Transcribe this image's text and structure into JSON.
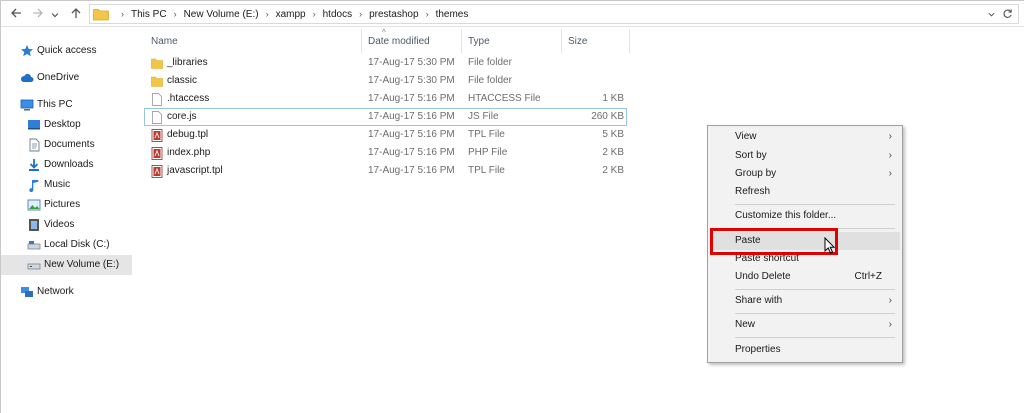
{
  "toolbar": {
    "back_icon": "arrow-left-icon",
    "forward_icon": "arrow-right-icon",
    "history_icon": "chevron-down-icon",
    "up_icon": "arrow-up-icon",
    "breadcrumb": [
      "This PC",
      "New Volume (E:)",
      "xampp",
      "htdocs",
      "prestashop",
      "themes"
    ],
    "refresh_icon": "refresh-icon"
  },
  "nav": {
    "items": [
      {
        "label": "Quick access",
        "icon": "star-icon"
      },
      {
        "label": "OneDrive",
        "icon": "cloud-icon"
      },
      {
        "label": "This PC",
        "icon": "computer-icon"
      },
      {
        "label": "Desktop",
        "icon": "desktop-icon"
      },
      {
        "label": "Documents",
        "icon": "documents-icon"
      },
      {
        "label": "Downloads",
        "icon": "download-icon"
      },
      {
        "label": "Music",
        "icon": "music-icon"
      },
      {
        "label": "Pictures",
        "icon": "pictures-icon"
      },
      {
        "label": "Videos",
        "icon": "videos-icon"
      },
      {
        "label": "Local Disk (C:)",
        "icon": "drive-icon"
      },
      {
        "label": "New Volume (E:)",
        "icon": "drive-icon"
      },
      {
        "label": "Network",
        "icon": "network-icon"
      }
    ],
    "selected": "New Volume (E:)"
  },
  "columns": {
    "name": "Name",
    "date": "Date modified",
    "type": "Type",
    "size": "Size"
  },
  "files": [
    {
      "name": "_libraries",
      "date": "17-Aug-17 5:30 PM",
      "type": "File folder",
      "size": "",
      "icon": "folder-icon"
    },
    {
      "name": "classic",
      "date": "17-Aug-17 5:30 PM",
      "type": "File folder",
      "size": "",
      "icon": "folder-icon"
    },
    {
      "name": ".htaccess",
      "date": "17-Aug-17 5:16 PM",
      "type": "HTACCESS File",
      "size": "1 KB",
      "icon": "file-icon"
    },
    {
      "name": "core.js",
      "date": "17-Aug-17 5:16 PM",
      "type": "JS File",
      "size": "260 KB",
      "icon": "file-icon"
    },
    {
      "name": "debug.tpl",
      "date": "17-Aug-17 5:16 PM",
      "type": "TPL File",
      "size": "5 KB",
      "icon": "tpl-file-icon"
    },
    {
      "name": "index.php",
      "date": "17-Aug-17 5:16 PM",
      "type": "PHP File",
      "size": "2 KB",
      "icon": "php-file-icon"
    },
    {
      "name": "javascript.tpl",
      "date": "17-Aug-17 5:16 PM",
      "type": "TPL File",
      "size": "2 KB",
      "icon": "tpl-file-icon"
    }
  ],
  "context_menu": {
    "items": [
      {
        "label": "View",
        "submenu": true
      },
      {
        "label": "Sort by",
        "submenu": true
      },
      {
        "label": "Group by",
        "submenu": true
      },
      {
        "label": "Refresh",
        "submenu": false
      },
      {
        "label": "Customize this folder...",
        "submenu": false
      },
      {
        "label": "Paste",
        "submenu": false
      },
      {
        "label": "Paste shortcut",
        "submenu": false
      },
      {
        "label": "Undo Delete",
        "shortcut": "Ctrl+Z"
      },
      {
        "label": "Share with",
        "submenu": true
      },
      {
        "label": "New",
        "submenu": true
      },
      {
        "label": "Properties",
        "submenu": false
      }
    ],
    "hovered": "Paste",
    "annotation_color": "#e00000"
  },
  "colors": {
    "folder": "#f3c64a",
    "selection": "#e5e5e5",
    "focus_border": "#99c5e0",
    "accent": "#0078d7"
  }
}
